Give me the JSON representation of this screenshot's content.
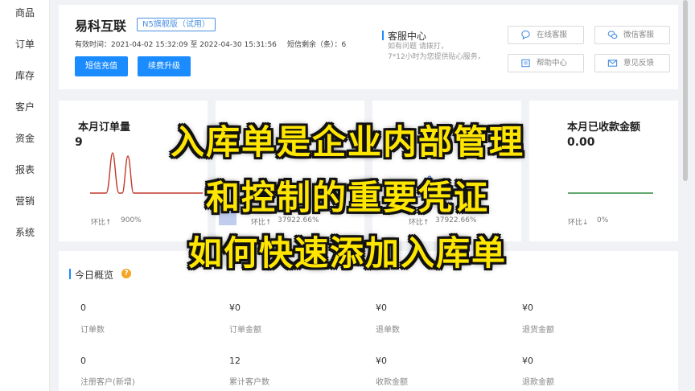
{
  "sidebar": {
    "items": [
      "商品",
      "订单",
      "库存",
      "客户",
      "资金",
      "报表",
      "营销",
      "系统"
    ]
  },
  "header": {
    "shop_name": "易科互联",
    "edition_tag": "N5旗舰版（试用）",
    "validity": "有效时间：2021-04-02 15:32:09 至 2022-04-30 15:31:56",
    "sms_remaining": "短信剩余（条）：6",
    "sms_recharge_label": "短信充值",
    "upgrade_label": "续费升级"
  },
  "service": {
    "title": "客服中心",
    "desc_line1": "如有问题 请拨打，",
    "desc_line2": "7*12小时为您提供贴心服务，",
    "buttons": {
      "online": "在线客服",
      "wechat": "微信客服",
      "help": "帮助中心",
      "feedback": "意见反馈"
    },
    "icons": [
      "chat-bubble-icon",
      "wechat-icon",
      "help-book-icon",
      "mail-icon"
    ]
  },
  "stats": {
    "orders": {
      "title": "本月订单量",
      "value": "9",
      "ratio_label": "环比↑",
      "ratio_value": "900%"
    },
    "card2": {
      "ratio_label": "环比↑",
      "ratio_value": "37922.66%"
    },
    "card3": {
      "ratio_label": "环比↑",
      "ratio_value": "37922.66%"
    },
    "collected": {
      "title": "本月已收款金额",
      "value": "0.00",
      "ratio_label": "环比↓",
      "ratio_value": "0%"
    }
  },
  "overview": {
    "title": "今日概览",
    "help_icon": "?",
    "row1": [
      {
        "value": "0",
        "label": "订单数"
      },
      {
        "value": "¥0",
        "label": "订单金额"
      },
      {
        "value": "¥0",
        "label": "退单数"
      },
      {
        "value": "¥0",
        "label": "退货金额"
      }
    ],
    "row2": [
      {
        "value": "0",
        "label": "注册客户(新增)"
      },
      {
        "value": "12",
        "label": "累计客户数"
      },
      {
        "value": "¥0",
        "label": "收款金额"
      },
      {
        "value": "¥0",
        "label": "退款金额"
      }
    ]
  },
  "overlay": {
    "line1": "入库单是企业内部管理",
    "line2": "和控制的重要凭证",
    "line3": "如何快速添加入库单"
  },
  "colors": {
    "primary": "#1a8cff",
    "orders_line": "#c0392b",
    "collected_line": "#2e8b3e",
    "card2_line": "#4a6fd1",
    "overlay_text": "#ffe600"
  }
}
